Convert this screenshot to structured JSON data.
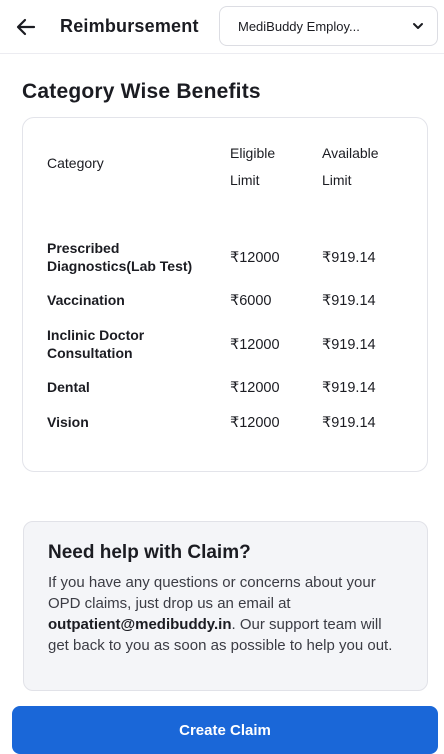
{
  "header": {
    "title": "Reimbursement",
    "employer_selected": "MediBuddy Employ..."
  },
  "benefits": {
    "section_title": "Category Wise Benefits",
    "columns": {
      "category": "Category",
      "eligible_line1": "Eligible",
      "eligible_line2": "Limit",
      "available_line1": "Available",
      "available_line2": "Limit"
    },
    "rows": [
      {
        "category_line1": "Prescribed",
        "category_line2": "Diagnostics(Lab Test)",
        "eligible": "₹12000",
        "available": "₹919.14"
      },
      {
        "category_line1": "Vaccination",
        "category_line2": "",
        "eligible": "₹6000",
        "available": "₹919.14"
      },
      {
        "category_line1": "Inclinic Doctor",
        "category_line2": "Consultation",
        "eligible": "₹12000",
        "available": "₹919.14"
      },
      {
        "category_line1": "Dental",
        "category_line2": "",
        "eligible": "₹12000",
        "available": "₹919.14"
      },
      {
        "category_line1": "Vision",
        "category_line2": "",
        "eligible": "₹12000",
        "available": "₹919.14"
      }
    ]
  },
  "help": {
    "title": "Need help with Claim?",
    "body_part1": "If you have any questions or concerns about your OPD claims, just drop us an email at ",
    "email": "outpatient@medibuddy.in",
    "body_part2": ". Our support team will get back to you as soon as possible to help you out."
  },
  "cta": {
    "label": "Create Claim"
  },
  "colors": {
    "primary": "#1a67d8",
    "text": "#1b1c22",
    "help_bg": "#f4f5f8"
  },
  "icons": {
    "back": "back-arrow-icon",
    "dropdown": "chevron-down-icon"
  }
}
